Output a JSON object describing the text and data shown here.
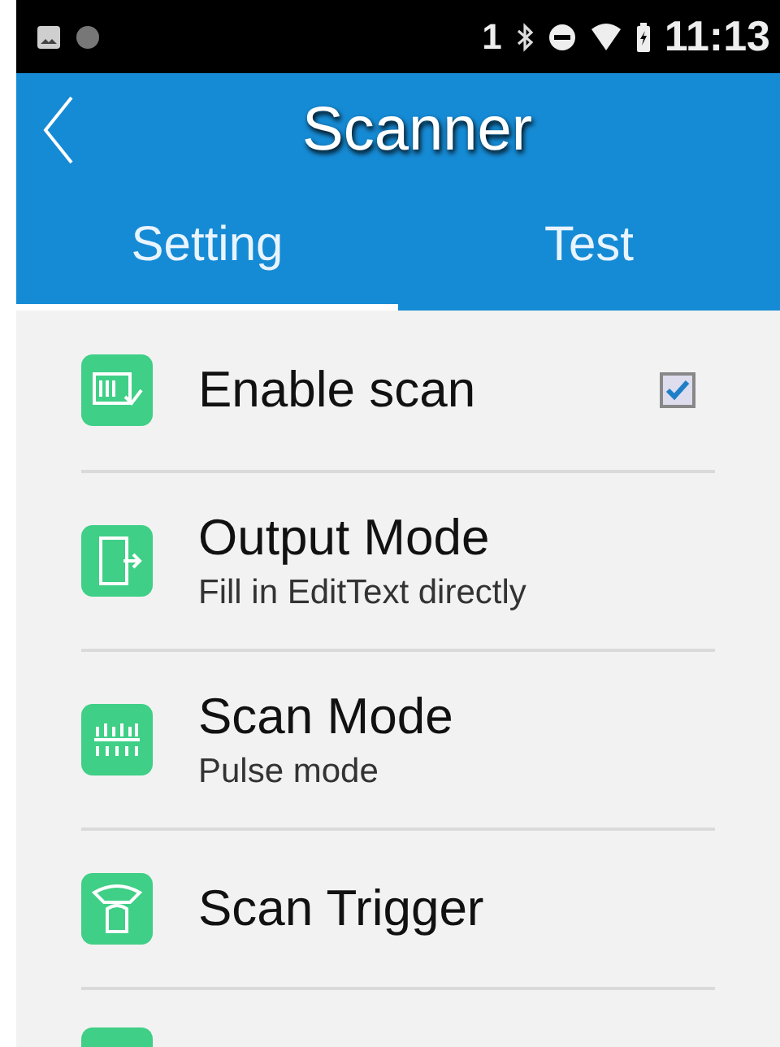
{
  "status_bar": {
    "sim_slot": "1",
    "time": "11:13"
  },
  "app_bar": {
    "title": "Scanner"
  },
  "tabs": [
    {
      "label": "Setting",
      "selected": true
    },
    {
      "label": "Test",
      "selected": false
    }
  ],
  "settings": [
    {
      "kind": "checkbox",
      "title": "Enable scan",
      "checked": true
    },
    {
      "kind": "detail",
      "title": "Output Mode",
      "summary": "Fill in EditText directly"
    },
    {
      "kind": "detail",
      "title": "Scan Mode",
      "summary": "Pulse mode"
    },
    {
      "kind": "plain",
      "title": "Scan Trigger"
    },
    {
      "kind": "cut"
    }
  ]
}
